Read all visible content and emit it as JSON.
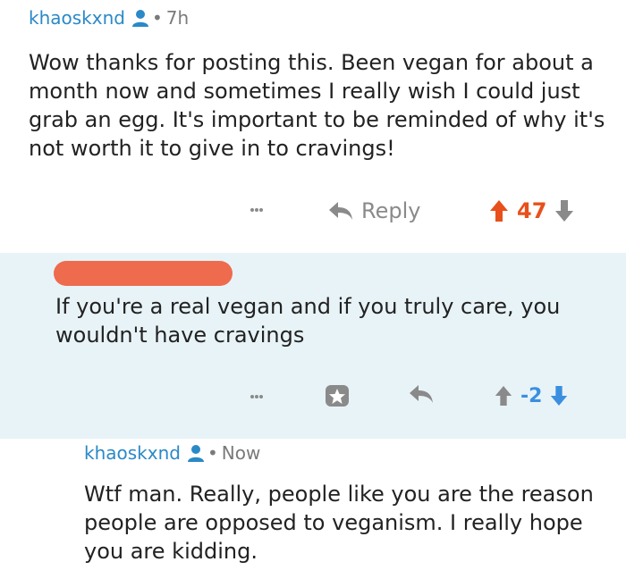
{
  "comments": [
    {
      "author": "khaoskxnd",
      "time": "7h",
      "text": "Wow thanks for posting this. Been vegan for about a month now and sometimes I really wish I could just grab an egg. It's important to be reminded of why it's not worth it to give in to cravings!",
      "reply_label": "Reply",
      "score": "47",
      "vote_state": "upvoted"
    },
    {
      "author_redacted": true,
      "text": "If you're a real vegan and if you truly care, you wouldn't have cravings",
      "score": "-2",
      "vote_state": "downvoted"
    },
    {
      "author": "khaoskxnd",
      "time": "Now",
      "text": "Wtf man. Really, people like you are the reason people are opposed to veganism. I really hope you are kidding."
    }
  ],
  "colors": {
    "author": "#2a89c7",
    "upvote": "#e8501b",
    "downvote": "#3b8fe0",
    "icon_gray": "#8a8a8a",
    "highlight_bg": "#e8f3f8",
    "redaction": "#ee6b4d"
  }
}
